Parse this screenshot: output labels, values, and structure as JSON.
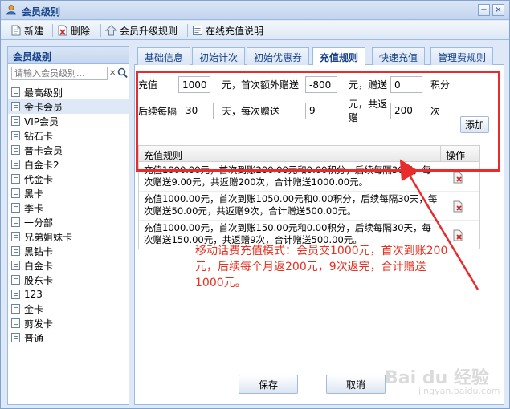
{
  "window": {
    "title": "会员级别"
  },
  "toolbar": {
    "new_label": "新建",
    "delete_label": "删除",
    "upgrade_rules_label": "会员升级规则",
    "online_recharge_label": "在线充值说明"
  },
  "sidebar": {
    "header": "会员级别",
    "search_placeholder": "请输入会员级别...",
    "items": [
      {
        "label": "最高级别"
      },
      {
        "label": "金卡会员"
      },
      {
        "label": "VIP会员"
      },
      {
        "label": "钻石卡"
      },
      {
        "label": "普卡会员"
      },
      {
        "label": "白金卡2"
      },
      {
        "label": "代金卡"
      },
      {
        "label": "黑卡"
      },
      {
        "label": "季卡"
      },
      {
        "label": "一分部"
      },
      {
        "label": "兄弟姐妹卡"
      },
      {
        "label": "黑钻卡"
      },
      {
        "label": "白金卡"
      },
      {
        "label": "股东卡"
      },
      {
        "label": "123"
      },
      {
        "label": "金卡"
      },
      {
        "label": "剪发卡"
      },
      {
        "label": "普通"
      }
    ],
    "selected_index": 1
  },
  "tabs": [
    {
      "label": "基础信息"
    },
    {
      "label": "初始计次"
    },
    {
      "label": "初始优惠券"
    },
    {
      "label": "充值规则"
    },
    {
      "label": "快速充值"
    },
    {
      "label": "管理费规则"
    }
  ],
  "active_tab": 3,
  "form": {
    "recharge_label": "充值",
    "recharge_value": "1000",
    "unit_yuan_first_extra": "元，首次额外赠送",
    "first_extra_value": "-800",
    "unit_yuan_gift": "元，赠送",
    "gift_points_value": "0",
    "unit_points": "积分",
    "interval_label": "后续每隔",
    "interval_value": "30",
    "unit_day_each_gift": "天，每次赠送",
    "each_gift_value": "9",
    "unit_yuan_total": "元，共返赠",
    "total_times_value": "200",
    "unit_times": "次",
    "add_label": "添加"
  },
  "grid": {
    "col_rule": "充值规则",
    "col_op": "操作",
    "rows": [
      {
        "text": "充值1000.00元，首次到账200.00元和0.00积分，后续每隔30天，每次赠送9.00元，共返赠200次，合计赠送1000.00元。"
      },
      {
        "text": "充值1000.00元，首次到账1050.00元和0.00积分，后续每隔30天，每次赠送50.00元，共返赠9次，合计赠送500.00元。"
      },
      {
        "text": "充值1000.00元，首次到账150.00元和0.00积分，后续每隔30天，每次赠送150.00元，共返赠9次，合计赠送500.00元。"
      }
    ]
  },
  "annotation": "移动话费充值模式：会员交1000元，首次到账200元，后续每个月返200元，9次返完，合计赠送1000元。",
  "buttons": {
    "save_label": "保存",
    "cancel_label": "取消"
  },
  "watermark": {
    "brand": "Bai du 经验",
    "sub": "jingyan.baidu.com"
  },
  "colors": {
    "accent_red": "#e82b2b",
    "header_blue": "#15428b"
  }
}
